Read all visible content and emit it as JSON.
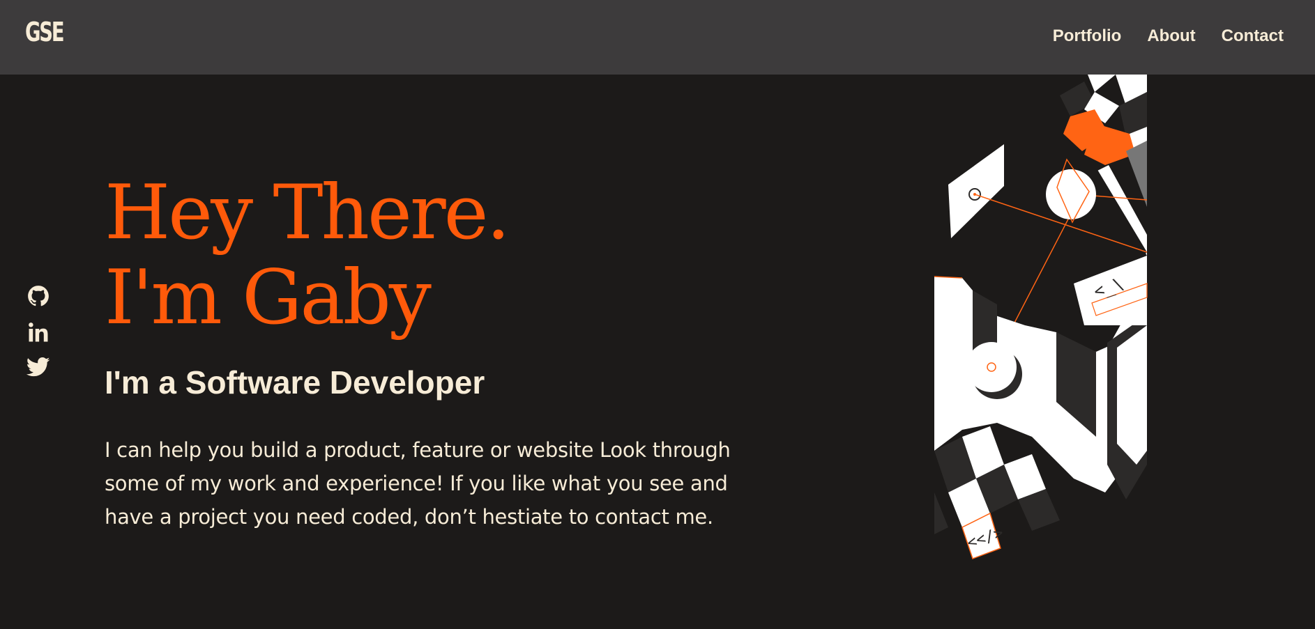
{
  "header": {
    "logo": "GSE",
    "nav": [
      {
        "label": "Portfolio"
      },
      {
        "label": "About"
      },
      {
        "label": "Contact"
      }
    ]
  },
  "socials": [
    {
      "icon": "github-icon"
    },
    {
      "icon": "linkedin-icon"
    },
    {
      "icon": "twitter-icon"
    }
  ],
  "hero": {
    "greeting_line1": "Hey There.",
    "greeting_line2": "I'm Gaby",
    "subtitle": "I'm a Software Developer",
    "description": "I can help you build a product, feature or website Look through some of my work and experience! If you like what you see and have a project you need coded, don’t hestiate to contact me."
  },
  "illustration": {
    "code_label_1": "<_\\",
    "code_label_2": "<</>"
  },
  "colors": {
    "background": "#1c1a19",
    "navbar": "#3d3b3c",
    "accent": "#ff5a0a",
    "text": "#f7ecd7"
  }
}
